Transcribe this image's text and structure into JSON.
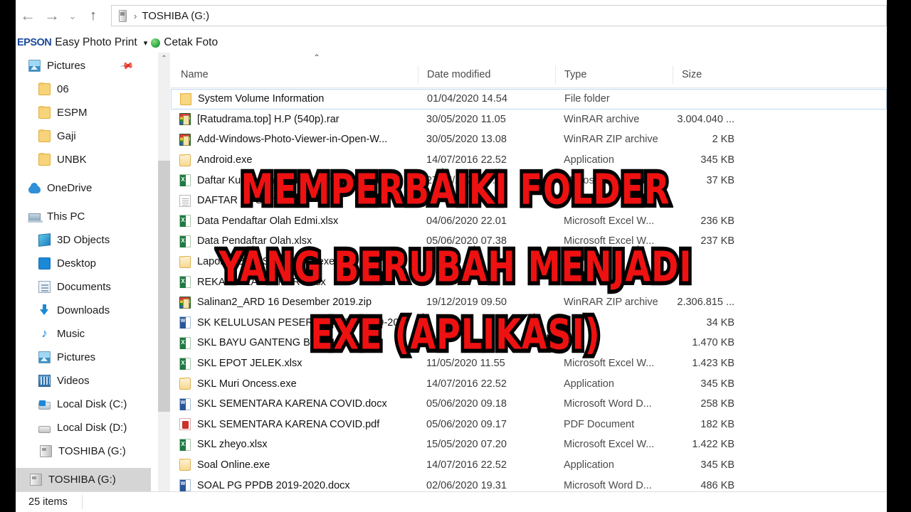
{
  "window": {
    "nav": {
      "back": "←",
      "forward": "→",
      "recent": "⌄",
      "up": "↑"
    },
    "address": {
      "separator": "›",
      "path": "TOSHIBA (G:)"
    }
  },
  "epson_toolbar": {
    "logo": "EPSON",
    "label": "Easy Photo Print",
    "caret": "▾",
    "action": "Cetak Foto"
  },
  "sidebar": {
    "items": [
      {
        "label": "Pictures",
        "icon": "picture-icon",
        "indent": false,
        "pinned": true
      },
      {
        "label": "06",
        "icon": "folder-icon",
        "indent": true
      },
      {
        "label": "ESPM",
        "icon": "folder-icon",
        "indent": true
      },
      {
        "label": "Gaji",
        "icon": "folder-icon",
        "indent": true
      },
      {
        "label": "UNBK",
        "icon": "folder-icon",
        "indent": true
      },
      {
        "label": "OneDrive",
        "icon": "cloud-icon",
        "indent": false
      },
      {
        "label": "This PC",
        "icon": "this-pc-icon",
        "indent": false
      },
      {
        "label": "3D Objects",
        "icon": "3d-objects-icon",
        "indent": true
      },
      {
        "label": "Desktop",
        "icon": "desktop-icon",
        "indent": true
      },
      {
        "label": "Documents",
        "icon": "documents-icon",
        "indent": true
      },
      {
        "label": "Downloads",
        "icon": "downloads-icon",
        "indent": true
      },
      {
        "label": "Music",
        "icon": "music-icon",
        "indent": true
      },
      {
        "label": "Pictures",
        "icon": "picture-icon",
        "indent": true
      },
      {
        "label": "Videos",
        "icon": "videos-icon",
        "indent": true
      },
      {
        "label": "Local Disk (C:)",
        "icon": "disk-c-icon",
        "indent": true
      },
      {
        "label": "Local Disk (D:)",
        "icon": "disk-d-icon",
        "indent": true
      },
      {
        "label": "TOSHIBA (G:)",
        "icon": "usb-drive-icon",
        "indent": true
      },
      {
        "label": "TOSHIBA (G:)",
        "icon": "usb-drive-icon",
        "indent": false,
        "selected": true
      }
    ],
    "scroll": {
      "up": "⌃",
      "down": "⌄"
    }
  },
  "file_list": {
    "sort_indicator": "⌃",
    "columns": [
      "Name",
      "Date modified",
      "Type",
      "Size"
    ],
    "rows": [
      {
        "name": "System Volume Information",
        "date": "01/04/2020 14.54",
        "type": "File folder",
        "size": "",
        "icon": "folder-icon",
        "selected": true
      },
      {
        "name": "[Ratudrama.top] H.P (540p).rar",
        "date": "30/05/2020 11.05",
        "type": "WinRAR archive",
        "size": "3.004.040 ...",
        "icon": "winrar-icon"
      },
      {
        "name": "Add-Windows-Photo-Viewer-in-Open-W...",
        "date": "30/05/2020 13.08",
        "type": "WinRAR ZIP archive",
        "size": "2 KB",
        "icon": "winrar-icon"
      },
      {
        "name": "Android.exe",
        "date": "14/07/2016 22.52",
        "type": "Application",
        "size": "345 KB",
        "icon": "folder-open-icon"
      },
      {
        "name": "Daftar Kumpulan lulusan form 2 MA MTs",
        "date": "27/05/2020 09.18",
        "type": "Microsoft Excel W...",
        "size": "37 KB",
        "icon": "excel-icon"
      },
      {
        "name": "DAFTAR MTS.txt",
        "date": "",
        "type": "",
        "size": "",
        "icon": "text-icon"
      },
      {
        "name": "Data Pendaftar Olah Edmi.xlsx",
        "date": "04/06/2020 22.01",
        "type": "Microsoft Excel W...",
        "size": "236 KB",
        "icon": "excel-icon"
      },
      {
        "name": "Data Pendaftar Olah.xlsx",
        "date": "05/06/2020 07.38",
        "type": "Microsoft Excel W...",
        "size": "237 KB",
        "icon": "excel-icon"
      },
      {
        "name": "Laporan BOP Semester 1.exe",
        "date": "",
        "type": "",
        "size": "",
        "icon": "folder-open-icon"
      },
      {
        "name": "REKAP NILAI RAPORT.xlsx",
        "date": "",
        "type": "",
        "size": "",
        "icon": "excel-icon"
      },
      {
        "name": "Salinan2_ARD 16 Desember 2019.zip",
        "date": "19/12/2019 09.50",
        "type": "WinRAR ZIP archive",
        "size": "2.306.815 ...",
        "icon": "winrar-icon"
      },
      {
        "name": "SK KELULUSAN PESERTA UN TP 2019-20...",
        "date": "",
        "type": "",
        "size": "34 KB",
        "icon": "word-icon"
      },
      {
        "name": "SKL BAYU GANTENG BARU.xlsx",
        "date": "",
        "type": "",
        "size": "1.470 KB",
        "icon": "excel-icon"
      },
      {
        "name": "SKL EPOT JELEK.xlsx",
        "date": "11/05/2020 11.55",
        "type": "Microsoft Excel W...",
        "size": "1.423 KB",
        "icon": "excel-icon"
      },
      {
        "name": "SKL Muri Oncess.exe",
        "date": "14/07/2016 22.52",
        "type": "Application",
        "size": "345 KB",
        "icon": "folder-open-icon"
      },
      {
        "name": "SKL SEMENTARA KARENA COVID.docx",
        "date": "05/06/2020 09.18",
        "type": "Microsoft Word D...",
        "size": "258 KB",
        "icon": "word-icon"
      },
      {
        "name": "SKL SEMENTARA KARENA COVID.pdf",
        "date": "05/06/2020 09.17",
        "type": "PDF Document",
        "size": "182 KB",
        "icon": "pdf-icon"
      },
      {
        "name": "SKL zheyo.xlsx",
        "date": "15/05/2020 07.20",
        "type": "Microsoft Excel W...",
        "size": "1.422 KB",
        "icon": "excel-icon"
      },
      {
        "name": "Soal Online.exe",
        "date": "14/07/2016 22.52",
        "type": "Application",
        "size": "345 KB",
        "icon": "folder-open-icon"
      },
      {
        "name": "SOAL PG PPDB 2019-2020.docx",
        "date": "02/06/2020 19.31",
        "type": "Microsoft Word D...",
        "size": "486 KB",
        "icon": "word-icon"
      }
    ]
  },
  "status_bar": {
    "item_count": "25 items"
  },
  "overlay_title": {
    "color": "#ee1111",
    "outline": "#000000",
    "lines": [
      "MEMPERBAIKI  FOLDER",
      "YANG  BERUBAH  MENJADI",
      "EXE  (APLIKASI)"
    ]
  }
}
